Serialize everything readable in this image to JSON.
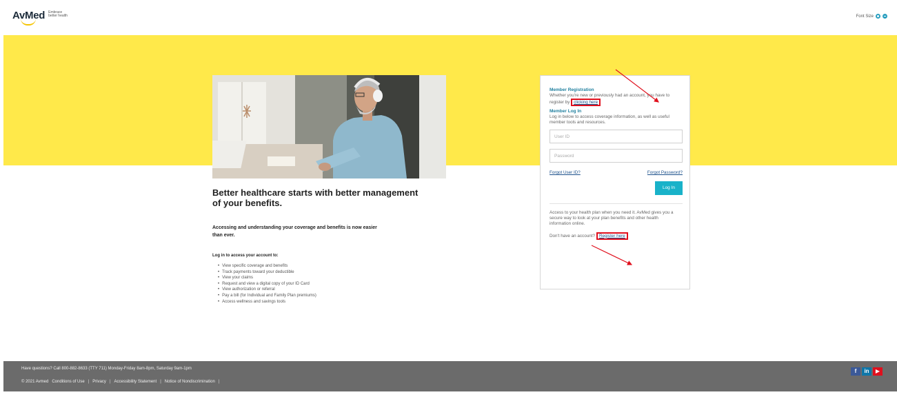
{
  "header": {
    "logo_text": "AvMed",
    "tagline": "Embrace better health",
    "font_size_label": "Font Size"
  },
  "hero": {
    "headline": "Better healthcare starts with better management of your benefits.",
    "subhead": "Accessing and understanding your coverage and benefits is now easier than ever.",
    "list_title": "Log in to access your account to:",
    "benefits": [
      "View specific coverage and benefits",
      "Track payments toward your deductible",
      "View your claims",
      "Request and view a digital copy of your ID Card",
      "View authorization or referral",
      "Pay a bill (for Individual and Family Plan premiums)",
      "Access wellness and savings tools"
    ]
  },
  "login": {
    "registration_title": "Member Registration",
    "registration_text": "Whether you're new or previously had an account, you have to register by",
    "registration_link": "clicking here",
    "login_title": "Member Log In",
    "login_text": "Log in below to access coverage information, as well as useful member tools and resources.",
    "userid_placeholder": "User ID",
    "password_placeholder": "Password",
    "forgot_user": "Forgot User ID?",
    "forgot_password": "Forgot Password?",
    "login_button": "Log In",
    "access_text": "Access to your health plan when you need it. AvMed gives you a secure way to look at your plan benefits and other health information online.",
    "no_account_text": "Don't have an account?",
    "register_link": "Register here"
  },
  "footer": {
    "questions": "Have questions? Call 800-882-8633 (TTY 711) Monday-Friday 8am-8pm, Saturday 9am-1pm",
    "copyright": "© 2021 Avmed",
    "links": [
      "Conditions of Use",
      "Privacy",
      "Accessibility Statement",
      "Notice of Nondiscrimination"
    ],
    "social": [
      "f",
      "in",
      "▶"
    ]
  },
  "colors": {
    "band_yellow": "#ffe94a",
    "accent_teal": "#19b2c9",
    "footer_gray": "#6b6b6b",
    "annotation_red": "#e0101d"
  }
}
